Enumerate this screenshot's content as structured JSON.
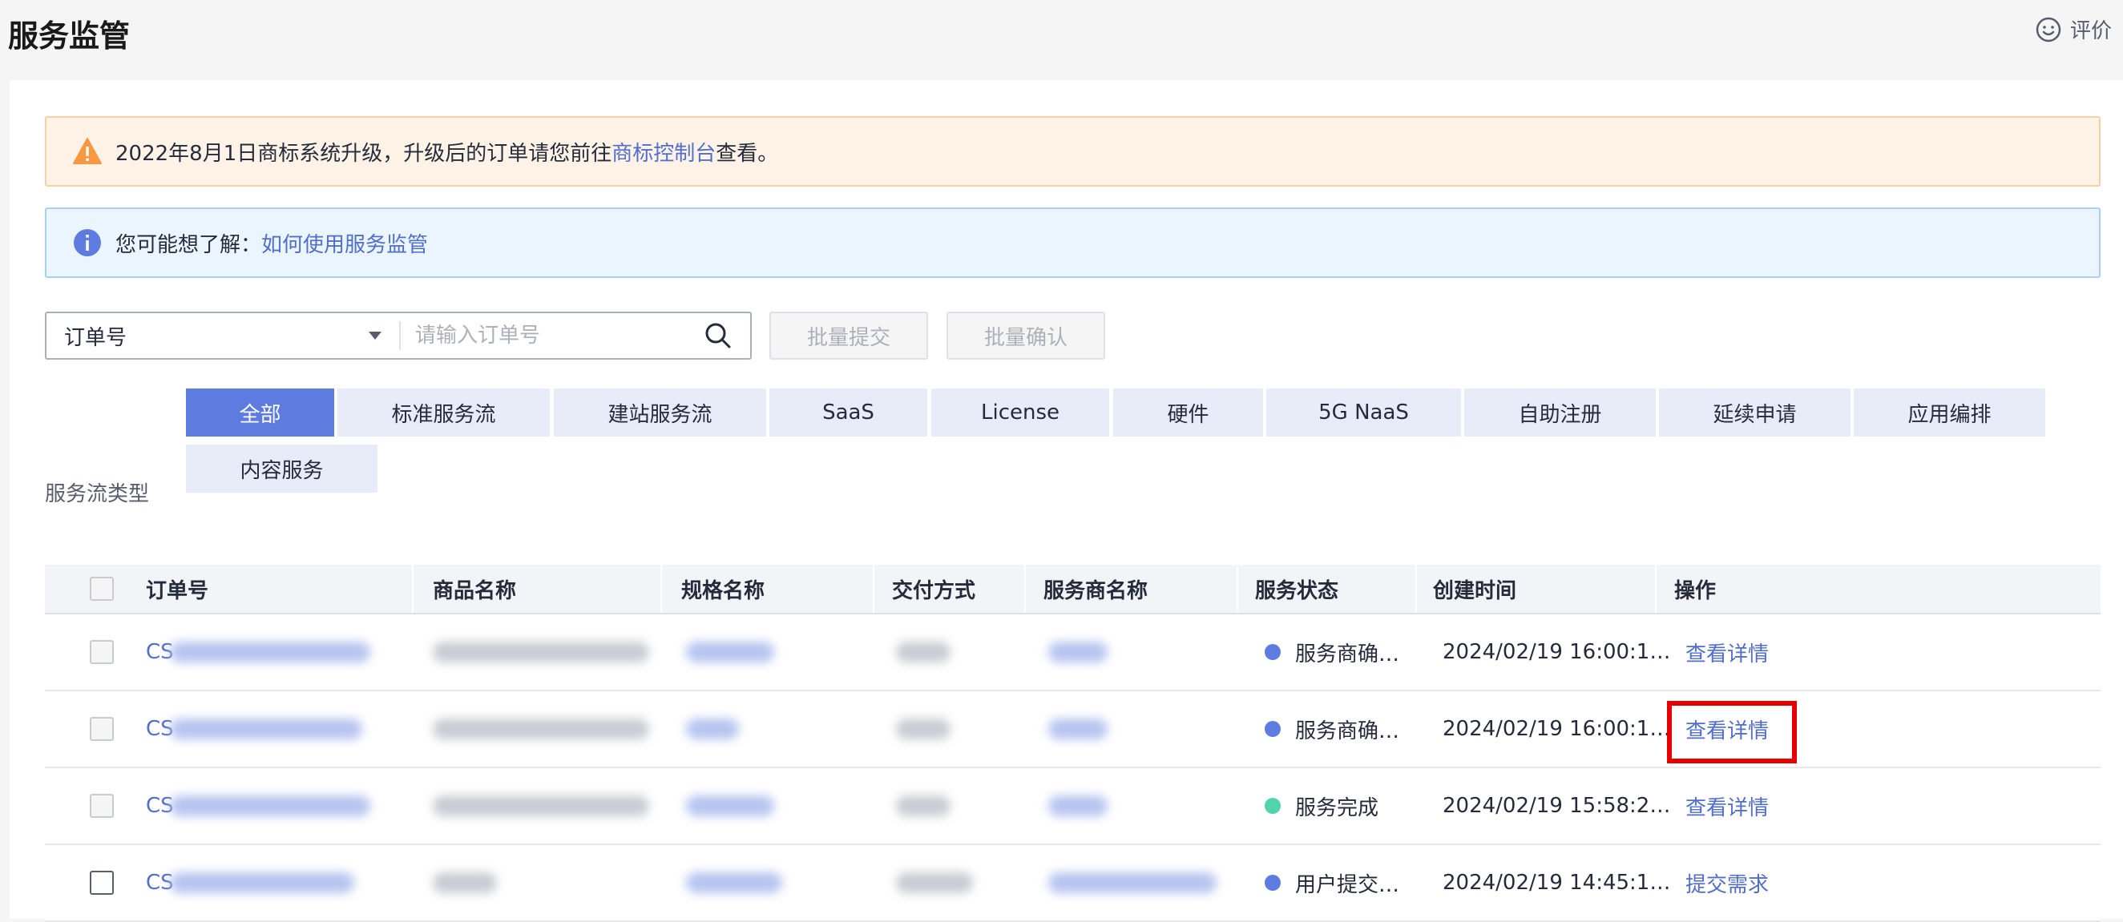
{
  "page": {
    "title": "服务监管",
    "feedback_label": "评价"
  },
  "alerts": {
    "warn_text": "2022年8月1日商标系统升级，升级后的订单请您前往",
    "warn_link": "商标控制台",
    "warn_suffix": "查看。",
    "info_text": "您可能想了解：",
    "info_link": "如何使用服务监管"
  },
  "search": {
    "field_select": "订单号",
    "placeholder": "请输入订单号",
    "batch_submit": "批量提交",
    "batch_confirm": "批量确认"
  },
  "filter": {
    "label": "服务流类型",
    "chips": [
      "全部",
      "标准服务流",
      "建站服务流",
      "SaaS",
      "License",
      "硬件",
      "5G NaaS",
      "自助注册",
      "延续申请",
      "应用编排",
      "内容服务"
    ],
    "active": "全部"
  },
  "table": {
    "headers": [
      "订单号",
      "商品名称",
      "规格名称",
      "交付方式",
      "服务商名称",
      "服务状态",
      "创建时间",
      "操作"
    ],
    "rows": [
      {
        "order_prefix": "CS",
        "status": "服务商确…",
        "status_color": "#5e7ce0",
        "created": "2024/02/19 16:00:1…",
        "action": "查看详情"
      },
      {
        "order_prefix": "CS",
        "status": "服务商确…",
        "status_color": "#5e7ce0",
        "created": "2024/02/19 16:00:1…",
        "action": "查看详情"
      },
      {
        "order_prefix": "CS",
        "status": "服务完成",
        "status_color": "#50d4ab",
        "created": "2024/02/19 15:58:2…",
        "action": "查看详情"
      },
      {
        "order_prefix": "CS",
        "status": "用户提交…",
        "status_color": "#5e7ce0",
        "created": "2024/02/19 14:45:1…",
        "action": "提交需求"
      }
    ]
  },
  "colors": {
    "accent": "#5e7ce0",
    "link": "#526ecc",
    "highlight": "#e60000"
  }
}
